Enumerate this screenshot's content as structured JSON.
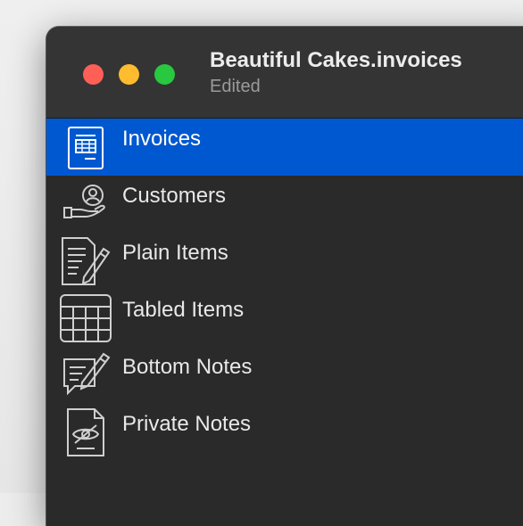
{
  "window": {
    "title": "Beautiful Cakes.invoices",
    "subtitle": "Edited"
  },
  "sidebar": {
    "items": [
      {
        "label": "Invoices",
        "icon": "invoice-icon",
        "selected": true
      },
      {
        "label": "Customers",
        "icon": "customer-icon",
        "selected": false
      },
      {
        "label": "Plain Items",
        "icon": "plain-items-icon",
        "selected": false
      },
      {
        "label": "Tabled Items",
        "icon": "table-icon",
        "selected": false
      },
      {
        "label": "Bottom Notes",
        "icon": "note-edit-icon",
        "selected": false
      },
      {
        "label": "Private Notes",
        "icon": "private-note-icon",
        "selected": false
      }
    ]
  },
  "colors": {
    "selection": "#0058d0",
    "sidebar_background": "#2a2a2a",
    "titlebar_background": "#343434",
    "close": "#fe5f57",
    "minimize": "#febc2e",
    "zoom": "#28c840"
  }
}
